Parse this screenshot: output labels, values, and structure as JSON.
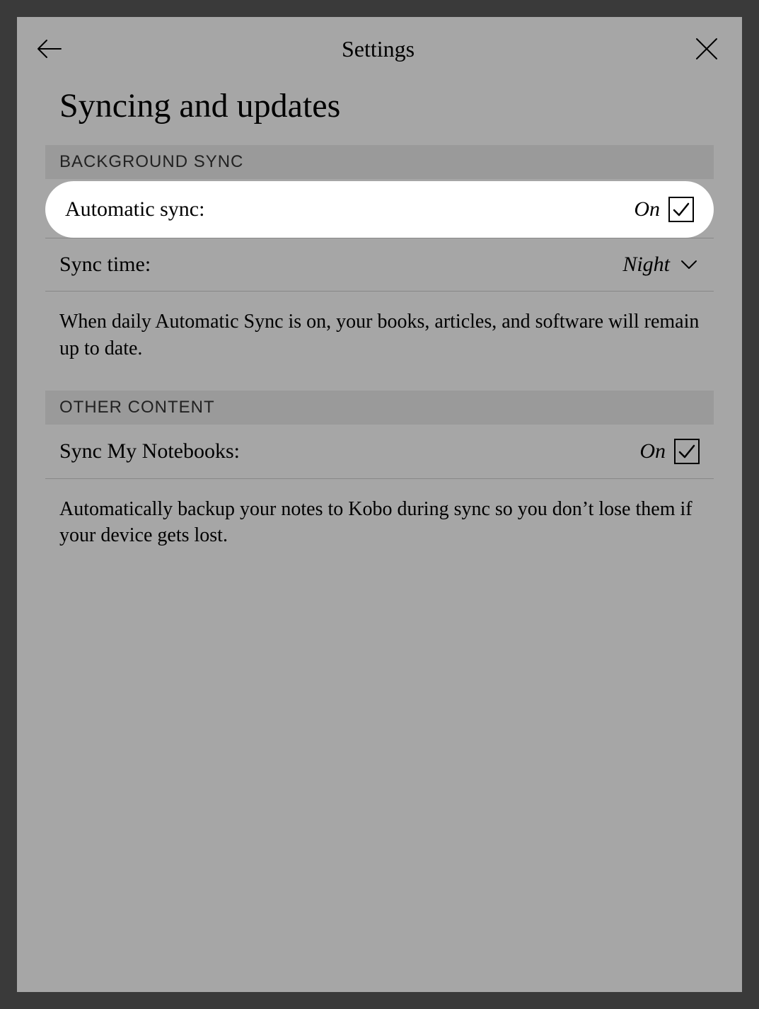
{
  "header": {
    "title": "Settings"
  },
  "page": {
    "title": "Syncing and updates"
  },
  "sections": {
    "background_sync": {
      "header": "BACKGROUND SYNC",
      "automatic_sync": {
        "label": "Automatic sync:",
        "value": "On"
      },
      "sync_time": {
        "label": "Sync time:",
        "value": "Night"
      },
      "description": "When daily Automatic Sync is on, your books, articles, and software will remain up to date."
    },
    "other_content": {
      "header": "OTHER CONTENT",
      "sync_notebooks": {
        "label": "Sync My Notebooks:",
        "value": "On"
      },
      "description": "Automatically backup your notes to Kobo during sync so you don’t lose them if your device gets lost."
    }
  }
}
